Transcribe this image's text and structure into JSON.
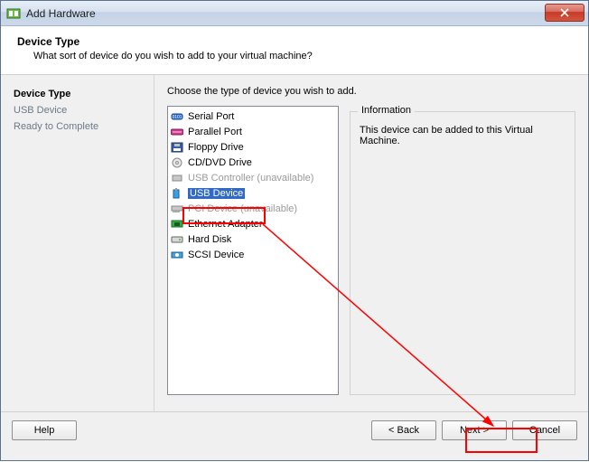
{
  "window": {
    "title": "Add Hardware"
  },
  "header": {
    "title": "Device Type",
    "subtitle": "What sort of device do you wish to add to your virtual machine?"
  },
  "steps": {
    "current": "Device Type",
    "s1": "USB Device",
    "s2": "Ready to Complete"
  },
  "content": {
    "instruction": "Choose the type of device you wish to add."
  },
  "devices": {
    "d0": "Serial Port",
    "d1": "Parallel Port",
    "d2": "Floppy Drive",
    "d3": "CD/DVD Drive",
    "d4": "USB Controller (unavailable)",
    "d5": "USB Device",
    "d6": "PCI Device (unavailable)",
    "d7": "Ethernet Adapter",
    "d8": "Hard Disk",
    "d9": "SCSI Device"
  },
  "info": {
    "legend": "Information",
    "text": "This device can be added to this Virtual Machine."
  },
  "buttons": {
    "help": "Help",
    "back": "< Back",
    "next": "Next >",
    "cancel": "Cancel"
  }
}
